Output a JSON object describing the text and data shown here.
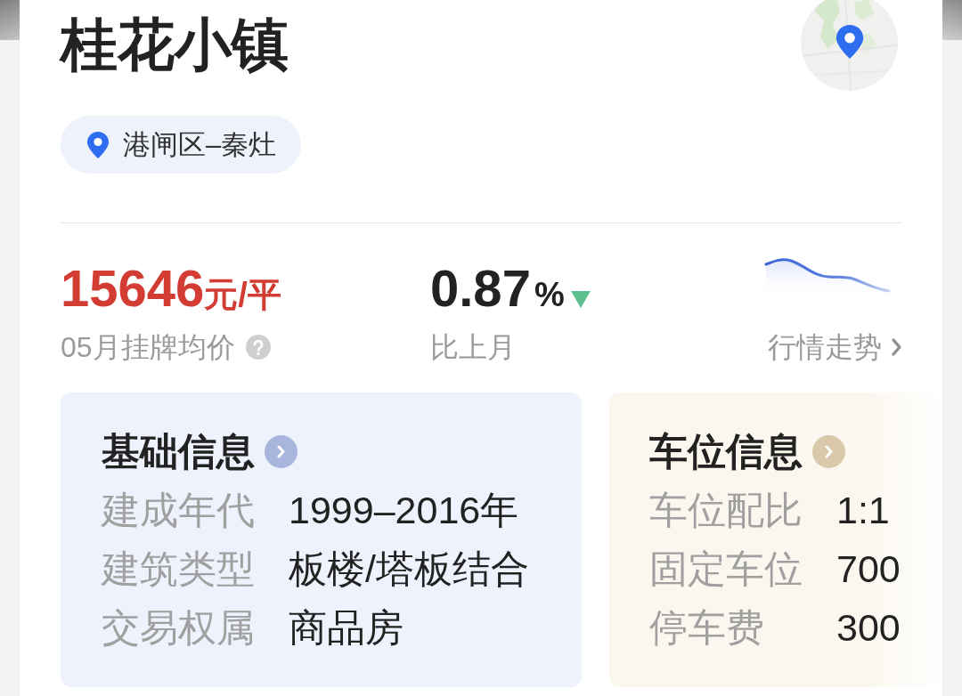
{
  "header": {
    "title": "桂花小镇",
    "location": "港闸区–秦灶"
  },
  "price": {
    "value": "15646",
    "unit": "元/平",
    "label": "05月挂牌均价"
  },
  "change": {
    "value": "0.87",
    "unit": "%",
    "falling": true,
    "label": "比上月"
  },
  "trend": {
    "label": "行情走势"
  },
  "info_cards": [
    {
      "kind": "basic",
      "title": "基础信息",
      "rows": [
        {
          "label": "建成年代",
          "value": "1999–2016年"
        },
        {
          "label": "建筑类型",
          "value": "板楼/塔板结合"
        },
        {
          "label": "交易权属",
          "value": "商品房"
        }
      ]
    },
    {
      "kind": "parking",
      "title": "车位信息",
      "rows": [
        {
          "label": "车位配比",
          "value": "1:1"
        },
        {
          "label": "固定车位",
          "value": "700"
        },
        {
          "label": "停车费",
          "value": "300"
        }
      ]
    }
  ]
}
